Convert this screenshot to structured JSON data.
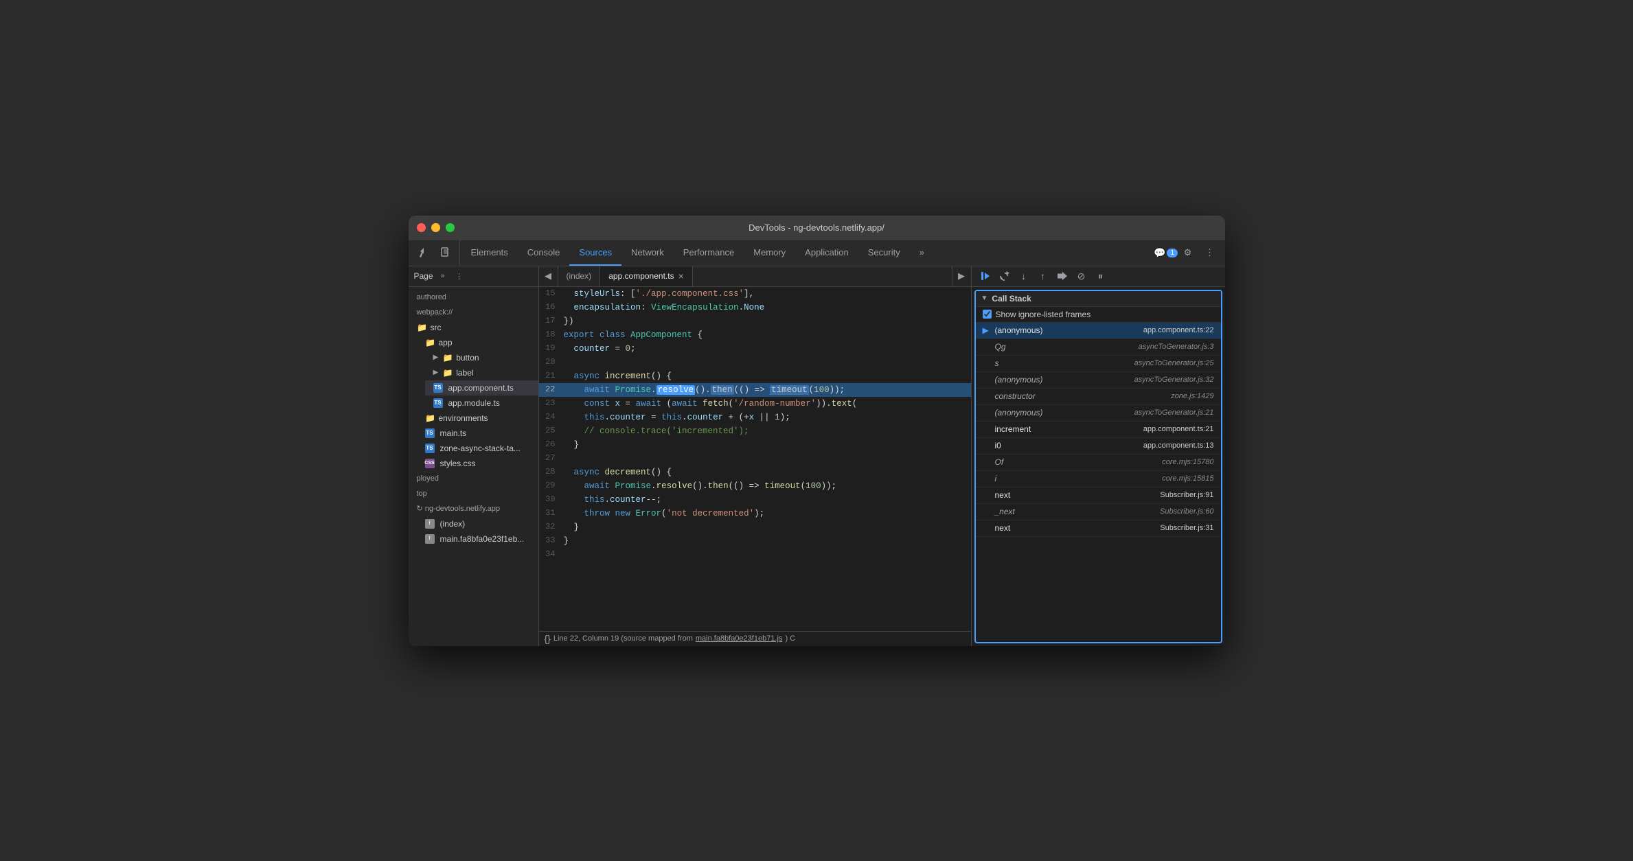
{
  "window": {
    "title": "DevTools - ng-devtools.netlify.app/"
  },
  "nav": {
    "tabs": [
      {
        "id": "elements",
        "label": "Elements",
        "active": false
      },
      {
        "id": "console",
        "label": "Console",
        "active": false
      },
      {
        "id": "sources",
        "label": "Sources",
        "active": true
      },
      {
        "id": "network",
        "label": "Network",
        "active": false
      },
      {
        "id": "performance",
        "label": "Performance",
        "active": false
      },
      {
        "id": "memory",
        "label": "Memory",
        "active": false
      },
      {
        "id": "application",
        "label": "Application",
        "active": false
      },
      {
        "id": "security",
        "label": "Security",
        "active": false
      }
    ],
    "badge_count": "1",
    "more_label": "»"
  },
  "sidebar": {
    "header_label": "Page",
    "items": [
      {
        "label": "authored",
        "type": "text",
        "indent": 0
      },
      {
        "label": "webpack://",
        "type": "text",
        "indent": 0
      },
      {
        "label": "src",
        "type": "folder-orange",
        "indent": 0
      },
      {
        "label": "app",
        "type": "folder-orange",
        "indent": 1
      },
      {
        "label": "button",
        "type": "folder-orange",
        "indent": 2,
        "collapsed": true
      },
      {
        "label": "label",
        "type": "folder-orange",
        "indent": 2,
        "collapsed": true
      },
      {
        "label": "app.component.ts",
        "type": "ts",
        "indent": 2,
        "selected": true
      },
      {
        "label": "app.module.ts",
        "type": "ts",
        "indent": 2
      },
      {
        "label": "environments",
        "type": "folder-orange",
        "indent": 1
      },
      {
        "label": "main.ts",
        "type": "ts",
        "indent": 1
      },
      {
        "label": "zone-async-stack-ta...",
        "type": "ts",
        "indent": 1
      },
      {
        "label": "styles.css",
        "type": "css",
        "indent": 1
      },
      {
        "label": "ployed",
        "type": "text",
        "indent": 0
      },
      {
        "label": "top",
        "type": "text",
        "indent": 0
      },
      {
        "label": "ng-devtools.netlify.app",
        "type": "globe",
        "indent": 0
      },
      {
        "label": "(index)",
        "type": "generic",
        "indent": 1
      },
      {
        "label": "main.fa8bfa0e23f1eb...",
        "type": "generic",
        "indent": 1
      }
    ]
  },
  "editor": {
    "tabs": [
      {
        "label": "(index)",
        "active": false
      },
      {
        "label": "app.component.ts",
        "active": true,
        "closeable": true
      }
    ],
    "lines": [
      {
        "num": 15,
        "content": "  styleUrls: ['./app.component.css'],"
      },
      {
        "num": 16,
        "content": "  encapsulation: ViewEncapsulation.None"
      },
      {
        "num": 17,
        "content": "})"
      },
      {
        "num": 18,
        "content": "export class AppComponent {"
      },
      {
        "num": 19,
        "content": "  counter = 0;"
      },
      {
        "num": 20,
        "content": ""
      },
      {
        "num": 21,
        "content": "  async increment() {"
      },
      {
        "num": 22,
        "content": "    await Promise.resolve().then(() => timeout(100));",
        "highlighted": true
      },
      {
        "num": 23,
        "content": "    const x = await (await fetch('/random-number')).text("
      },
      {
        "num": 24,
        "content": "    this.counter = this.counter + (+x || 1);"
      },
      {
        "num": 25,
        "content": "    // console.trace('incremented');"
      },
      {
        "num": 26,
        "content": "  }"
      },
      {
        "num": 27,
        "content": ""
      },
      {
        "num": 28,
        "content": "  async decrement() {"
      },
      {
        "num": 29,
        "content": "    await Promise.resolve().then(() => timeout(100));"
      },
      {
        "num": 30,
        "content": "    this.counter--;"
      },
      {
        "num": 31,
        "content": "    throw new Error('not decremented');"
      },
      {
        "num": 32,
        "content": "  }"
      },
      {
        "num": 33,
        "content": "}"
      },
      {
        "num": 34,
        "content": ""
      }
    ],
    "status_line": "Line 22, Column 19 (source mapped from main.fa8bfa0e23f1eb71.js) C"
  },
  "call_stack": {
    "header": "Call Stack",
    "show_ignore_label": "Show ignore-listed frames",
    "items": [
      {
        "name": "(anonymous)",
        "location": "app.component.ts:22",
        "current": true,
        "italic": false
      },
      {
        "name": "Qg",
        "location": "asyncToGenerator.js:3",
        "current": false,
        "italic": true
      },
      {
        "name": "s",
        "location": "asyncToGenerator.js:25",
        "current": false,
        "italic": true
      },
      {
        "name": "(anonymous)",
        "location": "asyncToGenerator.js:32",
        "current": false,
        "italic": true
      },
      {
        "name": "constructor",
        "location": "zone.js:1429",
        "current": false,
        "italic": true
      },
      {
        "name": "(anonymous)",
        "location": "asyncToGenerator.js:21",
        "current": false,
        "italic": true
      },
      {
        "name": "increment",
        "location": "app.component.ts:21",
        "current": false,
        "italic": false
      },
      {
        "name": "i0",
        "location": "app.component.ts:13",
        "current": false,
        "italic": false
      },
      {
        "name": "Of",
        "location": "core.mjs:15780",
        "current": false,
        "italic": true
      },
      {
        "name": "i",
        "location": "core.mjs:15815",
        "current": false,
        "italic": true
      },
      {
        "name": "next",
        "location": "Subscriber.js:91",
        "current": false,
        "italic": false
      },
      {
        "name": "_next",
        "location": "Subscriber.js:60",
        "current": false,
        "italic": true
      },
      {
        "name": "next",
        "location": "Subscriber.js:31",
        "current": false,
        "italic": false
      }
    ]
  },
  "debugger_toolbar": {
    "buttons": [
      {
        "id": "resume",
        "icon": "▶",
        "active": true
      },
      {
        "id": "step-over",
        "icon": "↺"
      },
      {
        "id": "step-into",
        "icon": "↓"
      },
      {
        "id": "step-out",
        "icon": "↑"
      },
      {
        "id": "step",
        "icon": "⇌"
      },
      {
        "id": "deactivate",
        "icon": "⊘"
      },
      {
        "id": "pause",
        "icon": "⏸"
      }
    ]
  }
}
